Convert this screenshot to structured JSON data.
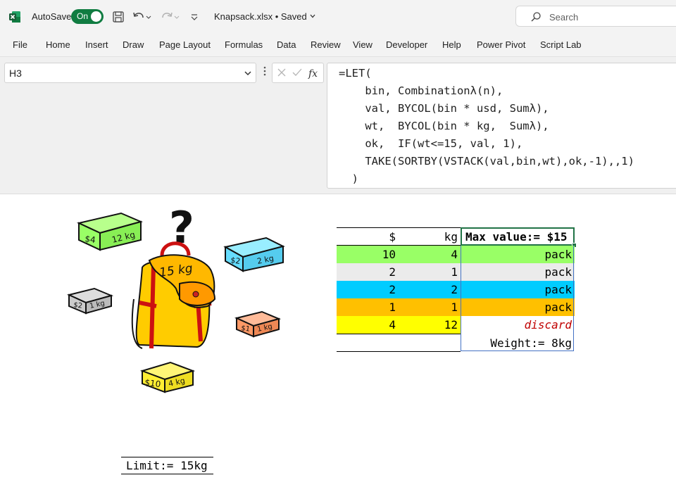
{
  "titlebar": {
    "autosave_label": "AutoSave",
    "autosave_state": "On",
    "filename": "Knapsack.xlsx",
    "save_status": "Saved",
    "search_placeholder": "Search"
  },
  "menu": [
    "File",
    "Home",
    "Insert",
    "Draw",
    "Page Layout",
    "Formulas",
    "Data",
    "Review",
    "View",
    "Developer",
    "Help",
    "Power Pivot",
    "Script Lab"
  ],
  "namebox": {
    "value": "H3"
  },
  "formula": {
    "lines": [
      "=LET(",
      "    bin, Combinationλ(n),",
      "    val, BYCOL(bin * usd, Sumλ),",
      "    wt,  BYCOL(bin * kg,  Sumλ),",
      "    ok,  IF(wt<=15, val, 1),",
      "    TAKE(SORTBY(VSTACK(val,bin,wt),ok,-1),,1)",
      "  )"
    ]
  },
  "illustration": {
    "question_mark": "?",
    "backpack_label": "15 kg",
    "boxes": [
      {
        "price": "$4",
        "weight": "12 kg",
        "color": "#99ff66"
      },
      {
        "price": "$2",
        "weight": "2 kg",
        "color": "#66ddff"
      },
      {
        "price": "$2",
        "weight": "1 kg",
        "color": "#cccccc"
      },
      {
        "price": "$1",
        "weight": "1 kg",
        "color": "#ff9966"
      },
      {
        "price": "$10",
        "weight": "4 kg",
        "color": "#ffee33"
      }
    ]
  },
  "table": {
    "col_usd": "$",
    "col_kg": "kg",
    "result_header": "Max value:= $15",
    "rows": [
      {
        "usd": "10",
        "kg": "4",
        "result": "pack",
        "color": "#99ff66"
      },
      {
        "usd": "2",
        "kg": "1",
        "result": "pack",
        "color": "#ebebeb"
      },
      {
        "usd": "2",
        "kg": "2",
        "result": "pack",
        "color": "#00ccff"
      },
      {
        "usd": "1",
        "kg": "1",
        "result": "pack",
        "color": "#ffc000"
      },
      {
        "usd": "4",
        "kg": "12",
        "result": "discard",
        "color": "#ffff00"
      }
    ],
    "weight_result": "Weight:= 8kg"
  },
  "limit": "Limit:= 15kg",
  "colors": {
    "excel_green": "#107c41",
    "discard_red": "#c00000",
    "selection_green": "#217346",
    "spill_blue": "#4472c4"
  }
}
